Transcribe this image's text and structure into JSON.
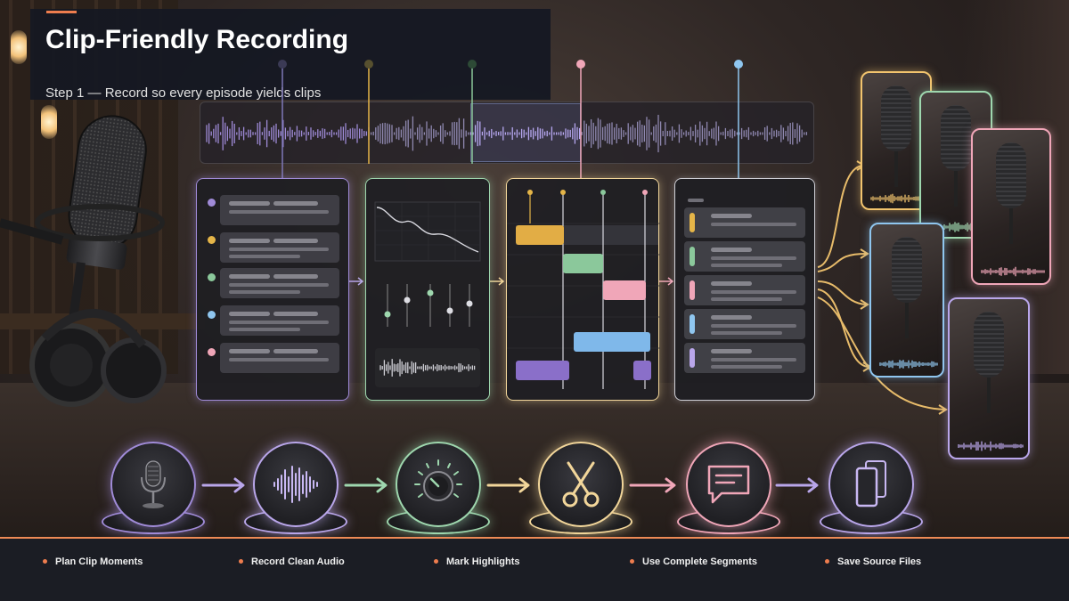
{
  "title": "Clip-Friendly Recording",
  "subtitle": "Step 1 — Record so every episode yields clips",
  "colors": {
    "accent": "#ee7d4e",
    "purple": "#a08bd8",
    "green": "#9ed7ae",
    "yellow": "#f2d69a",
    "pink": "#f0a6b8",
    "blue": "#8fc6ef"
  },
  "steps": [
    {
      "label": "Plan Clip Moments",
      "icon": "microphone-icon",
      "color": "#a08bd8"
    },
    {
      "label": "Record Clean Audio",
      "icon": "waveform-icon",
      "color": "#b9a6ea"
    },
    {
      "label": "Mark Highlights",
      "icon": "dial-icon",
      "color": "#9ed7ae"
    },
    {
      "label": "Use Complete Segments",
      "icon": "scissors-icon",
      "color": "#f2d69a"
    },
    {
      "label": "Save Source Files",
      "icon": "chat-icon",
      "color": "#f0a6b8"
    }
  ],
  "final_step_icon": "phone-icon"
}
